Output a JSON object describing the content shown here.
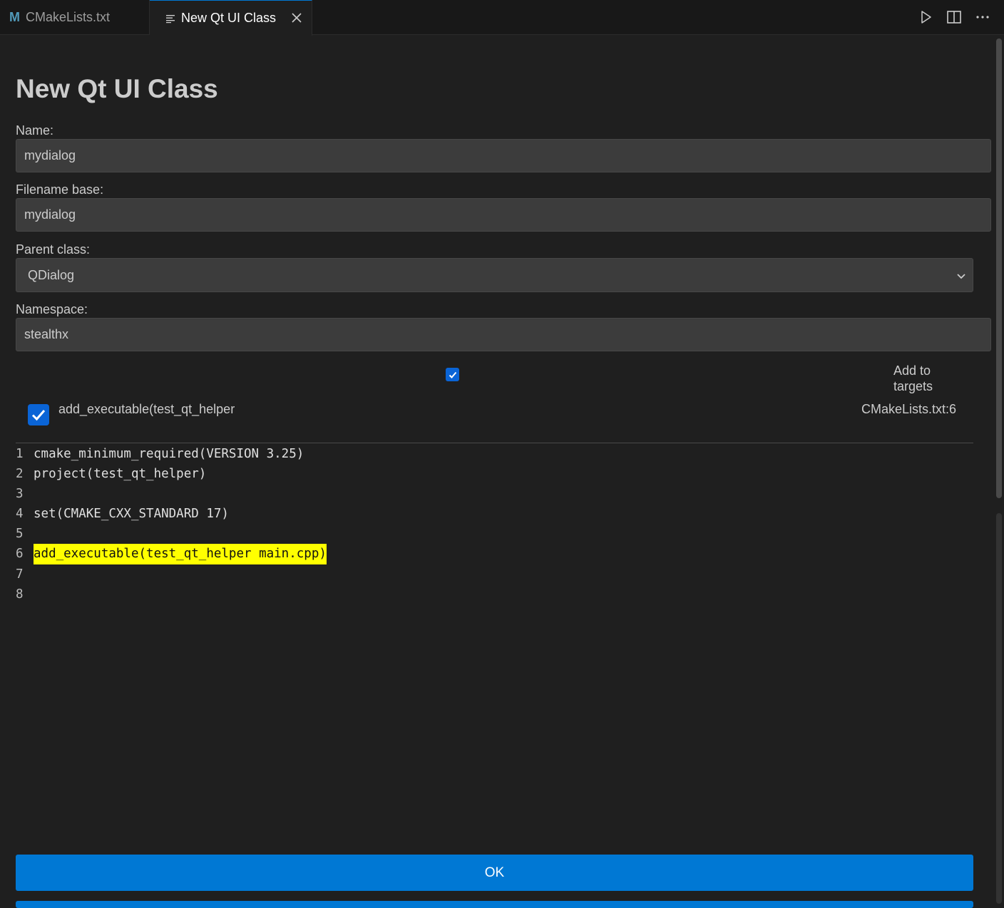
{
  "tabs": [
    {
      "label": "CMakeLists.txt",
      "icon": "cmake-m-icon",
      "active": false
    },
    {
      "label": "New Qt UI Class",
      "icon": "preview-lines-icon",
      "active": true
    }
  ],
  "editor_actions": [
    "run-icon",
    "split-editor-icon",
    "more-actions-icon"
  ],
  "form": {
    "title": "New Qt UI Class",
    "name_label": "Name:",
    "name_value": "mydialog",
    "filename_label": "Filename base:",
    "filename_value": "mydialog",
    "parent_label": "Parent class:",
    "parent_value": "QDialog",
    "namespace_label": "Namespace:",
    "namespace_value": "stealthx",
    "add_to_targets_label": "Add to targets",
    "add_to_targets_checked": true,
    "target": {
      "name": "add_executable(test_qt_helper",
      "location": "CMakeLists.txt:6",
      "checked": true
    }
  },
  "code": {
    "lines": [
      {
        "num": "1",
        "text": "cmake_minimum_required(VERSION 3.25)",
        "highlight": false
      },
      {
        "num": "2",
        "text": "project(test_qt_helper)",
        "highlight": false
      },
      {
        "num": "3",
        "text": "",
        "highlight": false
      },
      {
        "num": "4",
        "text": "set(CMAKE_CXX_STANDARD 17)",
        "highlight": false
      },
      {
        "num": "5",
        "text": "",
        "highlight": false
      },
      {
        "num": "6",
        "text": "add_executable(test_qt_helper main.cpp)",
        "highlight": true
      },
      {
        "num": "7",
        "text": "",
        "highlight": false
      },
      {
        "num": "8",
        "text": "",
        "highlight": false
      }
    ],
    "highlight_color": "#ffff00"
  },
  "buttons": {
    "ok_label": "OK"
  },
  "colors": {
    "accent": "#0078d4",
    "checkbox": "#0a64d6",
    "background": "#1f1f1f"
  }
}
